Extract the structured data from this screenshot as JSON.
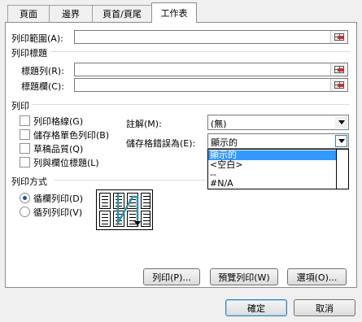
{
  "tabs": [
    {
      "label": "頁面"
    },
    {
      "label": "邊界"
    },
    {
      "label": "頁首/頁尾"
    },
    {
      "label": "工作表"
    }
  ],
  "print_area": {
    "label": "列印範圍(A):",
    "value": ""
  },
  "print_titles": {
    "heading": "列印標題",
    "rows_label": "標題列(R):",
    "rows_value": "",
    "cols_label": "標題欄(C):",
    "cols_value": ""
  },
  "print": {
    "heading": "列印",
    "gridlines": "列印格線(G)",
    "black_white": "儲存格單色列印(B)",
    "draft": "草稿品質(Q)",
    "row_col_headings": "列與欄位標題(L)",
    "comments_label": "註解(M):",
    "comments_value": "(無)",
    "errors_label": "儲存格錯誤為(E):",
    "errors_value": "顯示的",
    "errors_options": [
      "顯示的",
      "<空白>",
      "--",
      "#N/A"
    ],
    "errors_selected_index": 0
  },
  "page_order": {
    "heading": "列印方式",
    "down_then_over": "循欄列印(D)",
    "over_then_down": "循列列印(V)",
    "selected": "down_then_over"
  },
  "buttons": {
    "print": "列印(P)...",
    "preview": "預覽列印(W)",
    "options": "選項(O)...",
    "ok": "確定",
    "cancel": "取消"
  },
  "colors": {
    "selection": "#3399ff",
    "radio_dot": "#1c4f9c",
    "arrow": "#2f8fa8"
  }
}
